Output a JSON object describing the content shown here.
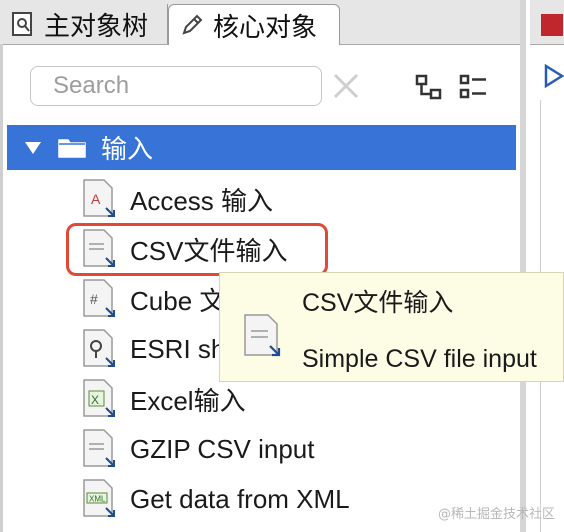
{
  "tabs": {
    "main_tree": "主对象树",
    "core_objects": "核心对象"
  },
  "search": {
    "placeholder": "Search"
  },
  "tree": {
    "root_label": "输入",
    "items": [
      {
        "label": "Access 输入",
        "icon": "access-file-icon"
      },
      {
        "label": "CSV文件输入",
        "icon": "csv-file-icon"
      },
      {
        "label": "Cube 文",
        "icon": "cube-file-icon"
      },
      {
        "label": "ESRI sh",
        "icon": "esri-file-icon"
      },
      {
        "label": "Excel输入",
        "icon": "excel-file-icon"
      },
      {
        "label": "GZIP CSV input",
        "icon": "gzip-file-icon"
      },
      {
        "label": "Get data from XML",
        "icon": "xml-file-icon"
      }
    ]
  },
  "tooltip": {
    "title": "CSV文件输入",
    "description": "Simple CSV file input"
  },
  "watermark": "@稀土掘金技术社区",
  "colors": {
    "selection": "#3874d8",
    "highlight_border": "#e04933",
    "tooltip_bg": "#fdfde6"
  }
}
